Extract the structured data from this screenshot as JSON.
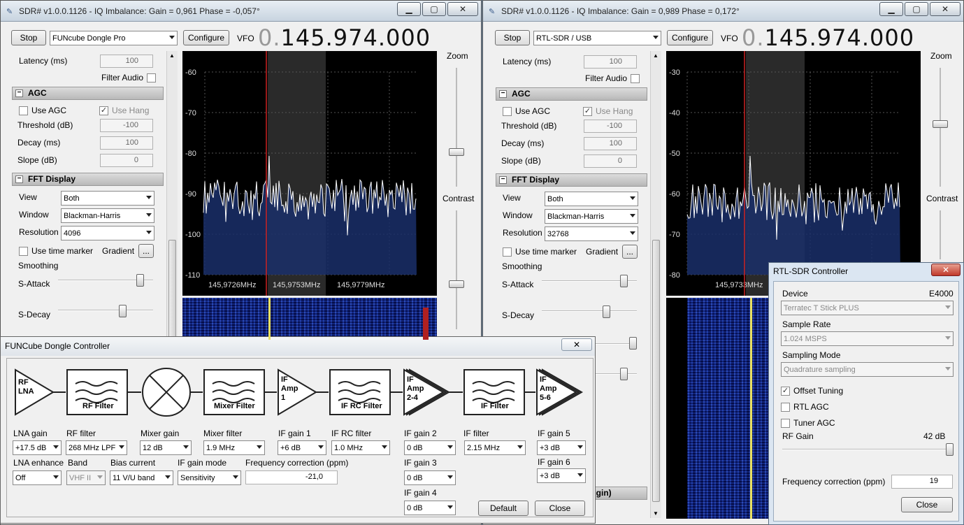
{
  "left": {
    "title": "SDR# v1.0.0.1126 - IQ Imbalance: Gain = 0,961 Phase = -0,057°",
    "stop": "Stop",
    "device": "FUNcube Dongle Pro",
    "configure": "Configure",
    "vfo_label": "VFO",
    "vfo_zero": "0.",
    "vfo_value": "145.974.000",
    "latency_label": "Latency (ms)",
    "latency": "100",
    "filter_audio": "Filter Audio",
    "agc": "AGC",
    "use_agc": "Use AGC",
    "use_hang": "Use Hang",
    "threshold_label": "Threshold (dB)",
    "threshold": "-100",
    "decay_label": "Decay (ms)",
    "decay": "100",
    "slope_label": "Slope (dB)",
    "slope": "0",
    "fft": "FFT Display",
    "view_label": "View",
    "view": "Both",
    "window_label": "Window",
    "window": "Blackman-Harris",
    "resolution_label": "Resolution",
    "resolution": "4096",
    "time_marker": "Use time marker",
    "gradient": "Gradient",
    "gradient_btn": "...",
    "smoothing": "Smoothing",
    "s_attack": "S-Attack",
    "s_decay": "S-Decay",
    "zoom": "Zoom",
    "contrast": "Contrast",
    "y_ticks": [
      "-60",
      "-70",
      "-80",
      "-90",
      "-100",
      "-110"
    ],
    "x_ticks": [
      "145,9726MHz",
      "145,9753MHz",
      "145,9779MHz"
    ]
  },
  "right": {
    "title": "SDR# v1.0.0.1126 - IQ Imbalance: Gain = 0,989 Phase = 0,172°",
    "stop": "Stop",
    "device": "RTL-SDR / USB",
    "configure": "Configure",
    "vfo_label": "VFO",
    "vfo_zero": "0.",
    "vfo_value": "145.974.000",
    "latency_label": "Latency (ms)",
    "latency": "100",
    "filter_audio": "Filter Audio",
    "agc": "AGC",
    "use_agc": "Use AGC",
    "use_hang": "Use Hang",
    "threshold_label": "Threshold (dB)",
    "threshold": "-100",
    "decay_label": "Decay (ms)",
    "decay": "100",
    "slope_label": "Slope (dB)",
    "slope": "0",
    "fft": "FFT Display",
    "view_label": "View",
    "view": "Both",
    "window_label": "Window",
    "window": "Blackman-Harris",
    "resolution_label": "Resolution",
    "resolution": "32768",
    "time_marker": "Use time marker",
    "gradient": "Gradient",
    "gradient_btn": "...",
    "smoothing": "Smoothing",
    "s_attack": "S-Attack",
    "s_decay": "S-Decay",
    "zoom": "Zoom",
    "contrast": "Contrast",
    "y_ticks": [
      "-30",
      "-40",
      "-50",
      "-60",
      "-70",
      "-80"
    ],
    "x_ticks": [
      "145,9733MHz"
    ],
    "plugin_fragment": "lugin)"
  },
  "funcube": {
    "title": "FUNCube Dongle Controller",
    "blocks": [
      "RF\nLNA",
      "RF Filter",
      "Mixer Filter",
      "IF\nAmp\n1",
      "IF RC Filter",
      "IF\nAmp\n2-4",
      "IF Filter",
      "IF\nAmp\n5-6"
    ],
    "lna_gain_label": "LNA gain",
    "lna_gain": "+17.5 dB",
    "rf_filter_label": "RF filter",
    "rf_filter": "268 MHz LPF",
    "mixer_gain_label": "Mixer gain",
    "mixer_gain": "12 dB",
    "mixer_filter_label": "Mixer filter",
    "mixer_filter": "1.9 MHz",
    "if_gain1_label": "IF gain 1",
    "if_gain1": "+6 dB",
    "if_rc_filter_label": "IF RC filter",
    "if_rc_filter": "1.0 MHz",
    "if_gain2_label": "IF gain 2",
    "if_gain2": "0 dB",
    "if_filter_label": "IF filter",
    "if_filter": "2.15 MHz",
    "if_gain5_label": "IF gain 5",
    "if_gain5": "+3 dB",
    "lna_enhance_label": "LNA enhance",
    "lna_enhance": "Off",
    "band_label": "Band",
    "band": "VHF II",
    "bias_label": "Bias current",
    "bias": "11 V/U band",
    "if_mode_label": "IF gain mode",
    "if_mode": "Sensitivity",
    "freq_corr_label": "Frequency correction (ppm)",
    "freq_corr": "-21,0",
    "if_gain3_label": "IF gain 3",
    "if_gain3": "0 dB",
    "if_gain4_label": "IF gain 4",
    "if_gain4": "0 dB",
    "if_gain6_label": "IF gain 6",
    "if_gain6": "+3 dB",
    "default": "Default",
    "close": "Close"
  },
  "rtl": {
    "title": "RTL-SDR Controller",
    "device_label": "Device",
    "device_tuner": "E4000",
    "device": "Terratec T Stick PLUS",
    "sample_rate_label": "Sample Rate",
    "sample_rate": "1.024 MSPS",
    "sampling_mode_label": "Sampling Mode",
    "sampling_mode": "Quadrature sampling",
    "offset_tuning": "Offset Tuning",
    "rtl_agc": "RTL AGC",
    "tuner_agc": "Tuner AGC",
    "rf_gain_label": "RF Gain",
    "rf_gain": "42 dB",
    "freq_corr_label": "Frequency correction (ppm)",
    "freq_corr": "19",
    "close": "Close"
  },
  "colors": {
    "spectrum_line": "#ffffff",
    "fill": "#1a2f6a",
    "marker": "#cc2222",
    "waterfall_trace": "#e8e060"
  }
}
